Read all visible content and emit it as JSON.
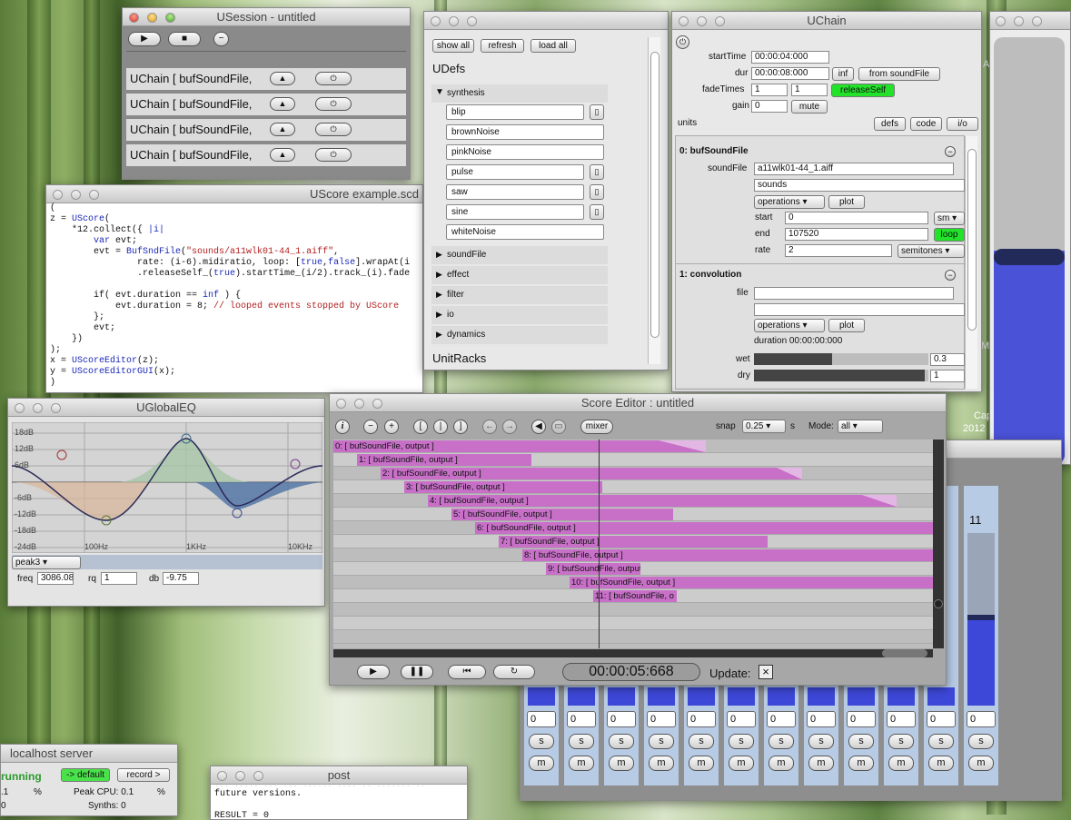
{
  "colors": {
    "accent_green": "#22e22a",
    "event_purple": "#c870c8",
    "mixer_blue": "#3d48d8"
  },
  "usession": {
    "title": "USession - untitled",
    "chain_label": "UChain [ bufSoundFile,",
    "rows": 4
  },
  "udefs": {
    "show_all": "show all",
    "refresh": "refresh",
    "load_all": "load all",
    "heading": "UDefs",
    "synth_group": "synthesis",
    "synth_items": [
      "blip",
      "brownNoise",
      "pinkNoise",
      "pulse",
      "saw",
      "sine",
      "whiteNoise"
    ],
    "synth_has_doc": [
      true,
      false,
      false,
      true,
      true,
      true,
      false
    ],
    "groups": [
      "soundFile",
      "effect",
      "filter",
      "io",
      "dynamics"
    ],
    "racks": "UnitRacks"
  },
  "uchain": {
    "title": "UChain",
    "start_label": "startTime",
    "start": "00:00:04:000",
    "dur_label": "dur",
    "dur": "00:00:08:000",
    "inf": "inf",
    "from_sf": "from soundFile",
    "fade_label": "fadeTimes",
    "fade1": "1",
    "fade2": "1",
    "release": "releaseSelf",
    "gain_label": "gain",
    "gain": "0",
    "mute": "mute",
    "units": "units",
    "defs": "defs",
    "code": "code",
    "io": "i/o",
    "u0": {
      "name": "0: bufSoundFile",
      "sf_label": "soundFile",
      "sf": "a11wlk01-44_1.aiff",
      "sounds": "sounds",
      "ops": "operations",
      "plot": "plot",
      "start_label": "start",
      "start": "0",
      "start_unit": "sm",
      "end_label": "end",
      "end": "107520",
      "loop": "loop",
      "rate_label": "rate",
      "rate": "2",
      "rate_unit": "semitones"
    },
    "u1": {
      "name": "1: convolution",
      "file_label": "file",
      "ops": "operations",
      "plot": "plot",
      "duration": "duration   00:00:00:000",
      "wet_label": "wet",
      "wet": "0.3",
      "wet_level": 0.45,
      "dry_label": "dry",
      "dry": "1",
      "dry_level": 0.98
    }
  },
  "uscore": {
    "title": "UScore example.scd"
  },
  "geq": {
    "title": "UGlobalEQ",
    "db_labels": [
      "18dB",
      "12dB",
      "6dB",
      "-6dB",
      "-12dB",
      "-18dB",
      "-24dB"
    ],
    "hz_labels": [
      "100Hz",
      "1KHz",
      "10KHz"
    ],
    "band": "peak3",
    "freq_label": "freq",
    "freq": "3086.08",
    "rq_label": "rq",
    "rq": "1",
    "db_label": "db",
    "db": "-9.75"
  },
  "score": {
    "title": "Score Editor : untitled",
    "mixer": "mixer",
    "snap_label": "snap",
    "snap": "0.25",
    "snap_unit": "s",
    "mode_label": "Mode:",
    "mode": "all",
    "events": [
      "0: [ bufSoundFile, output ]",
      "1: [ bufSoundFile, output ]",
      "2: [ bufSoundFile, output ]",
      "3: [ bufSoundFile, output ]",
      "4: [ bufSoundFile, output ]",
      "5: [ bufSoundFile, output ]",
      "6: [ bufSoundFile, output ]",
      "7: [ bufSoundFile, output ]",
      "8: [ bufSoundFile, output ]",
      "9: [ bufSoundFile, output",
      "10: [ bufSoundFile, output ]",
      "11: [ bufSoundFile, o"
    ],
    "time": "00:00:05:668",
    "update": "Update:",
    "update_box": "×"
  },
  "mixer": {
    "channel_label": "11",
    "value": "0",
    "solo": "s",
    "mute": "m",
    "channels": 12
  },
  "server": {
    "title": "localhost server",
    "status": "running",
    "default": "-> default",
    "record": "record >",
    "cpu_a": ".1",
    "pct": "%",
    "peak": "Peak CPU: 0.1",
    "pct2": "%",
    "synths": "Synths: 0",
    "zero": "0"
  },
  "post": {
    "title": "post",
    "l1": "future versions.",
    "l2": "RESULT = 0",
    "l0": "... ..... ... ... ...... .... .. ....... .."
  },
  "desktop": {
    "cap1": "Cap",
    "cap2": "2",
    "cap3": "Cap",
    "cap4": "2012",
    "a": "A",
    "m": "M"
  }
}
